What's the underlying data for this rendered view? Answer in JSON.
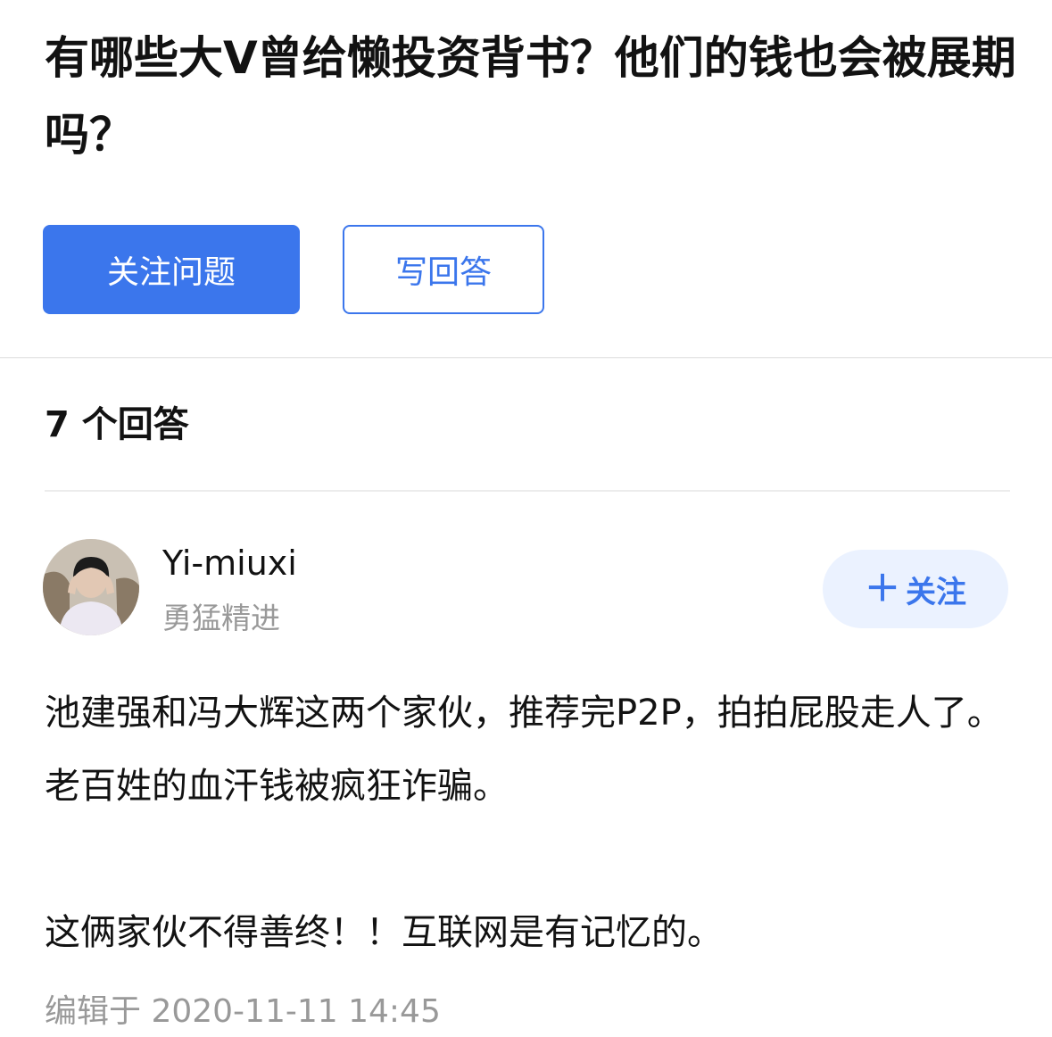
{
  "question": {
    "title": "有哪些大V曾给懒投资背书？他们的钱也会被展期吗？",
    "follow_button_label": "关注问题",
    "write_answer_label": "写回答"
  },
  "answers": {
    "count_label": "7 个回答",
    "items": [
      {
        "author": {
          "name": "Yi-miuxi",
          "bio": "勇猛精进",
          "follow_label": "关注",
          "follow_icon": "plus-icon"
        },
        "paragraphs": [
          "池建强和冯大辉这两个家伙，推荐完P2P，拍拍屁股走人了。老百姓的血汗钱被疯狂诈骗。",
          "这俩家伙不得善终！！互联网是有记忆的。"
        ],
        "edited_label": "编辑于 2020-11-11 14:45"
      }
    ]
  },
  "colors": {
    "accent": "#3b76ec",
    "accent_light": "#ebf2ff",
    "muted_text": "#999999",
    "primary_text": "#121212"
  }
}
